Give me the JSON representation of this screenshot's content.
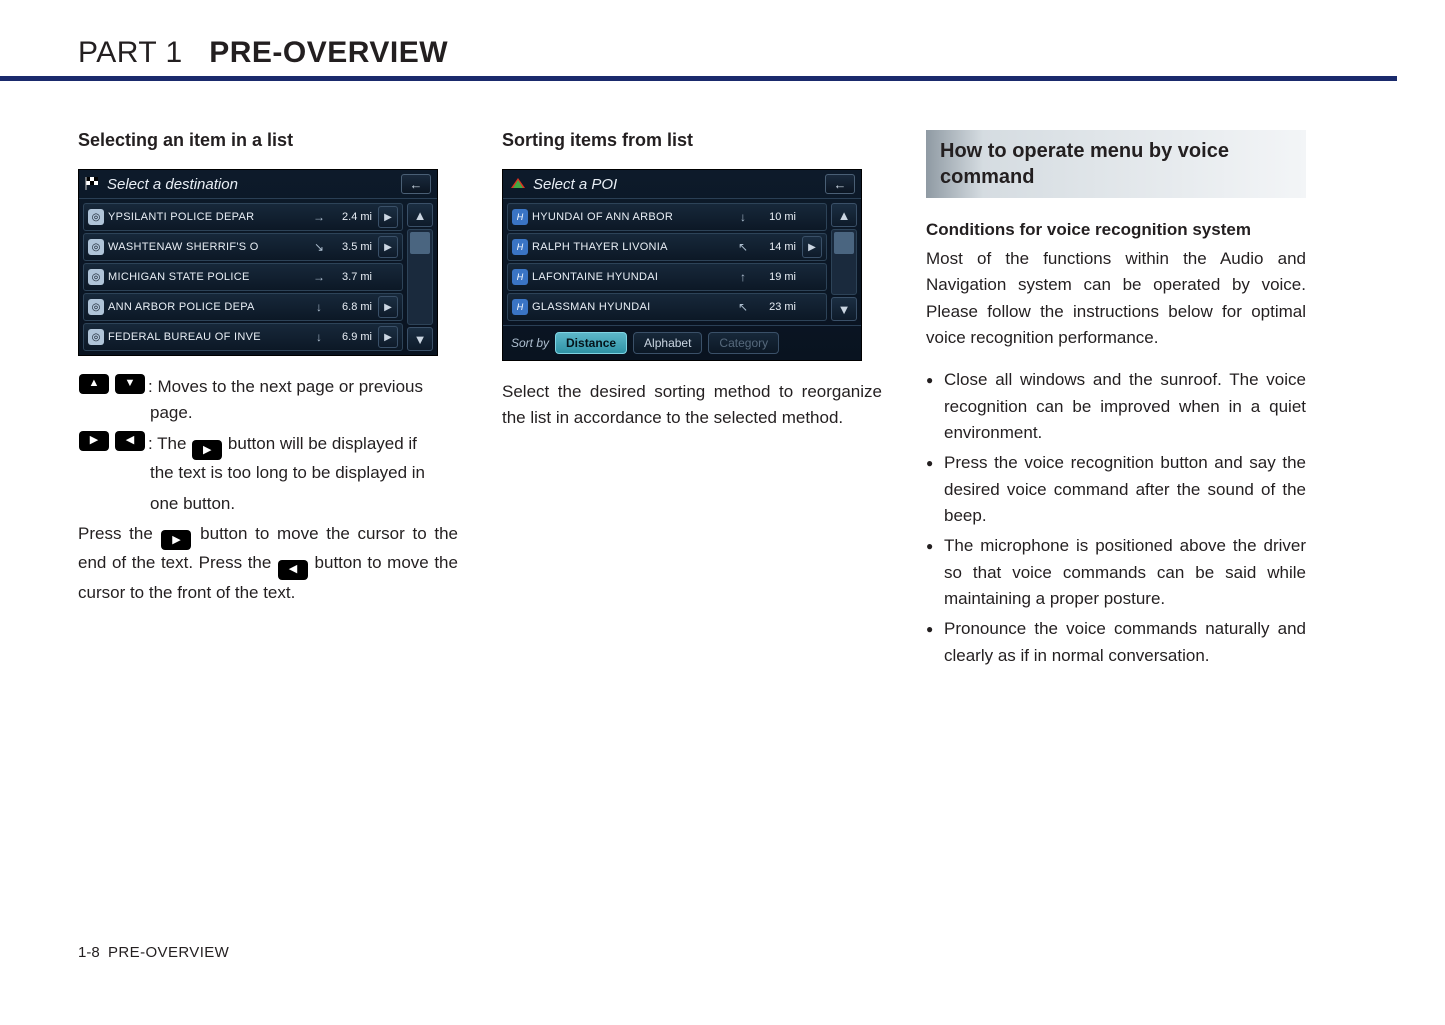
{
  "header": {
    "part": "PART 1",
    "name": "PRE-OVERVIEW"
  },
  "footer": {
    "page": "1-8",
    "section": "PRE-OVERVIEW"
  },
  "col1": {
    "heading": "Selecting an item in a list",
    "screen": {
      "title": "Select a destination",
      "rows": [
        {
          "label": "YPSILANTI POLICE DEPAR",
          "arrow": "→",
          "dist": "2.4 mi",
          "expand": true
        },
        {
          "label": "WASHTENAW SHERRIF'S O",
          "arrow": "↘",
          "dist": "3.5 mi",
          "expand": true
        },
        {
          "label": "MICHIGAN STATE POLICE",
          "arrow": "→",
          "dist": "3.7 mi",
          "expand": false
        },
        {
          "label": "ANN ARBOR POLICE DEPA",
          "arrow": "↓",
          "dist": "6.8 mi",
          "expand": true
        },
        {
          "label": "FEDERAL BUREAU OF INVE",
          "arrow": "↓",
          "dist": "6.9 mi",
          "expand": true
        }
      ]
    },
    "legend1_a": ": Moves to the next page or previous",
    "legend1_b": "page.",
    "legend2_a": ": The",
    "legend2_b": "button will be displayed if",
    "legend2_c": "the text is too long to be displayed in",
    "legend2_d": "one button.",
    "para_a": "Press the",
    "para_b": "button to move the cursor to",
    "para_c": "the end of the text. Press the",
    "para_d": "button to",
    "para_e": "move the cursor to the front of the text."
  },
  "col2": {
    "heading": "Sorting items from list",
    "screen": {
      "title": "Select a POI",
      "rows": [
        {
          "label": "HYUNDAI OF ANN ARBOR",
          "arrow": "↓",
          "dist": "10 mi",
          "expand": false
        },
        {
          "label": "RALPH THAYER LIVONIA",
          "arrow": "↖",
          "dist": "14 mi",
          "expand": true
        },
        {
          "label": "LAFONTAINE HYUNDAI",
          "arrow": "↑",
          "dist": "19 mi",
          "expand": false
        },
        {
          "label": "GLASSMAN HYUNDAI",
          "arrow": "↖",
          "dist": "23 mi",
          "expand": false
        }
      ],
      "sort_label": "Sort by",
      "tabs": {
        "distance": "Distance",
        "alphabet": "Alphabet",
        "category": "Category"
      }
    },
    "para": "Select the desired sorting method to reorga­nize the list in accordance to the selected method."
  },
  "col3": {
    "boxed": "How to operate menu by voice command",
    "sub": "Conditions for voice recognition system",
    "para": "Most of the functions within the Audio and Navigation system can be operated by voice. Please follow the  instructions below for opti­mal voice recognition performance.",
    "bullets": [
      "Close all windows and  the sunroof. The voice recognition can be improved when in a quiet environment.",
      "Press the voice recognition button and say the desired voice command after the sound of the beep.",
      "The microphone is positioned above the driver so that voice commands can be said while maintaining a proper posture.",
      "Pronounce the voice commands naturally and clearly as if in normal conversation."
    ]
  }
}
